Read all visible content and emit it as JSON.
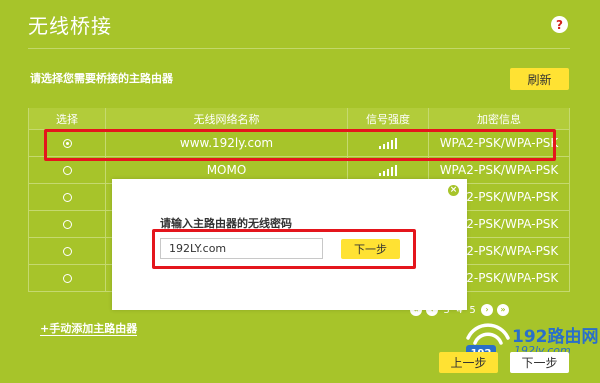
{
  "page": {
    "title": "无线桥接",
    "help_icon_glyph": "?"
  },
  "section": {
    "label": "请选择您需要桥接的主路由器",
    "refresh_label": "刷新"
  },
  "table": {
    "headers": [
      "选择",
      "无线网络名称",
      "信号强度",
      "加密信息"
    ],
    "rows": [
      {
        "selected": true,
        "ssid": "www.192ly.com",
        "signal": 5,
        "security": "WPA2-PSK/WPA-PSK"
      },
      {
        "selected": false,
        "ssid": "MOMO",
        "signal": 5,
        "security": "WPA2-PSK/WPA-PSK"
      },
      {
        "selected": false,
        "ssid": "",
        "signal": null,
        "security": "WPA2-PSK/WPA-PSK"
      },
      {
        "selected": false,
        "ssid": "",
        "signal": null,
        "security": "WPA2-PSK/WPA-PSK"
      },
      {
        "selected": false,
        "ssid": "",
        "signal": null,
        "security": "WPA2-PSK/WPA-PSK"
      },
      {
        "selected": false,
        "ssid": "",
        "signal": null,
        "security": "WPA2-PSK/WPA-PSK"
      }
    ]
  },
  "modal": {
    "label": "请输入主路由器的无线密码",
    "password_value": "192LY.com",
    "next_label": "下一步",
    "close_glyph": "×"
  },
  "pagination": {
    "pages": [
      "3",
      "4",
      "5"
    ],
    "prev_glyph": "‹",
    "first_glyph": "«",
    "next_glyph": "›",
    "last_glyph": "»"
  },
  "footer": {
    "add_link": "+手动添加主路由器",
    "prev_label": "上一步",
    "next_label": "下一步"
  },
  "watermark": {
    "brand": "192路由网",
    "url": "192ly.com",
    "badge": "192"
  },
  "colors": {
    "background": "#a7c42a",
    "accent_yellow": "#ffe233",
    "highlight_red": "#e4151c",
    "watermark_blue": "#2a6fc9"
  }
}
